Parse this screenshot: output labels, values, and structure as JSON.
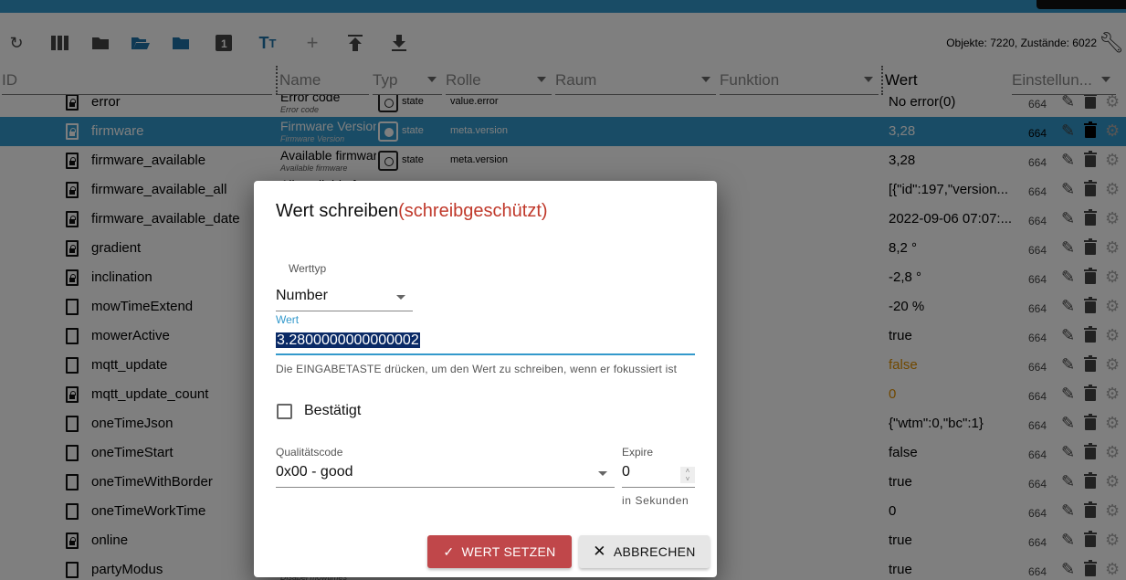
{
  "colors": {
    "accent": "#3399cc",
    "readonly": "#c0392b",
    "ok_button": "#c0474a",
    "ack_false": "#e09000"
  },
  "toolbar": {
    "icons": [
      "refresh-icon",
      "columns-icon",
      "folder-icon",
      "folder-open-icon",
      "folder-blue-icon",
      "one-icon",
      "text-size-icon",
      "plus-icon",
      "upload-icon",
      "download-icon"
    ],
    "stats": "Objekte: 7220, Zustände: 6022"
  },
  "header": {
    "id": "ID",
    "name": "Name",
    "typ": "Typ",
    "rolle": "Rolle",
    "raum": "Raum",
    "funktion": "Funktion",
    "wert": "Wert",
    "einstellungen": "Einstellun..."
  },
  "rows": [
    {
      "id": "error",
      "lock": true,
      "name": "Error code",
      "name2": "Error code",
      "type": "state",
      "role": "value.error",
      "value": "No error(0)",
      "perm": "664"
    },
    {
      "id": "firmware",
      "lock": true,
      "name": "Firmware Version",
      "name2": "Firmware Version",
      "type": "state",
      "role": "meta.version",
      "value": "3,28",
      "perm": "664",
      "selected": true
    },
    {
      "id": "firmware_available",
      "lock": true,
      "name": "Available firmware",
      "name2": "Available firmware",
      "type": "state",
      "role": "meta.version",
      "value": "3,28",
      "perm": "664"
    },
    {
      "id": "firmware_available_all",
      "lock": true,
      "name": "All available f",
      "value": "[{\"id\":197,\"version...",
      "perm": "664"
    },
    {
      "id": "firmware_available_date",
      "lock": true,
      "value": "2022-09-06 07:07:...",
      "perm": "664"
    },
    {
      "id": "gradient",
      "lock": true,
      "value": "8,2 °",
      "perm": "664"
    },
    {
      "id": "inclination",
      "lock": true,
      "value": "-2,8 °",
      "perm": "664"
    },
    {
      "id": "mowTimeExtend",
      "lock": false,
      "value": "-20 %",
      "perm": "664"
    },
    {
      "id": "mowerActive",
      "lock": false,
      "value": "true",
      "perm": "664"
    },
    {
      "id": "mqtt_update",
      "lock": false,
      "value": "false",
      "perm": "664",
      "orange": true
    },
    {
      "id": "mqtt_update_count",
      "lock": true,
      "value": "0",
      "perm": "664",
      "orange": true
    },
    {
      "id": "oneTimeJson",
      "lock": false,
      "value": "{\"wtm\":0,\"bc\":1}",
      "perm": "664"
    },
    {
      "id": "oneTimeStart",
      "lock": false,
      "value": "false",
      "perm": "664"
    },
    {
      "id": "oneTimeWithBorder",
      "lock": false,
      "value": "true",
      "perm": "664"
    },
    {
      "id": "oneTimeWorkTime",
      "lock": false,
      "value": "0",
      "perm": "664"
    },
    {
      "id": "online",
      "lock": true,
      "value": "true",
      "perm": "664"
    },
    {
      "id": "partyModus",
      "lock": false,
      "value": "true",
      "perm": "664",
      "name2": "Disabel mowtimes"
    }
  ],
  "dialog": {
    "title": "Wert schreiben",
    "readonly": "(schreibgeschützt)",
    "werttyp_label": "Werttyp",
    "werttyp": "Number",
    "wert_label": "Wert",
    "wert": "3.2800000000000002",
    "helper": "Die EINGABETASTE drücken, um den Wert zu schreiben, wenn er fokussiert ist",
    "ack_label": "Bestätigt",
    "quality_label": "Qualitätscode",
    "quality": "0x00 - good",
    "expire_label": "Expire",
    "expire": "0",
    "expire_helper": "in Sekunden",
    "ok": "WERT SETZEN",
    "cancel": "ABBRECHEN"
  }
}
